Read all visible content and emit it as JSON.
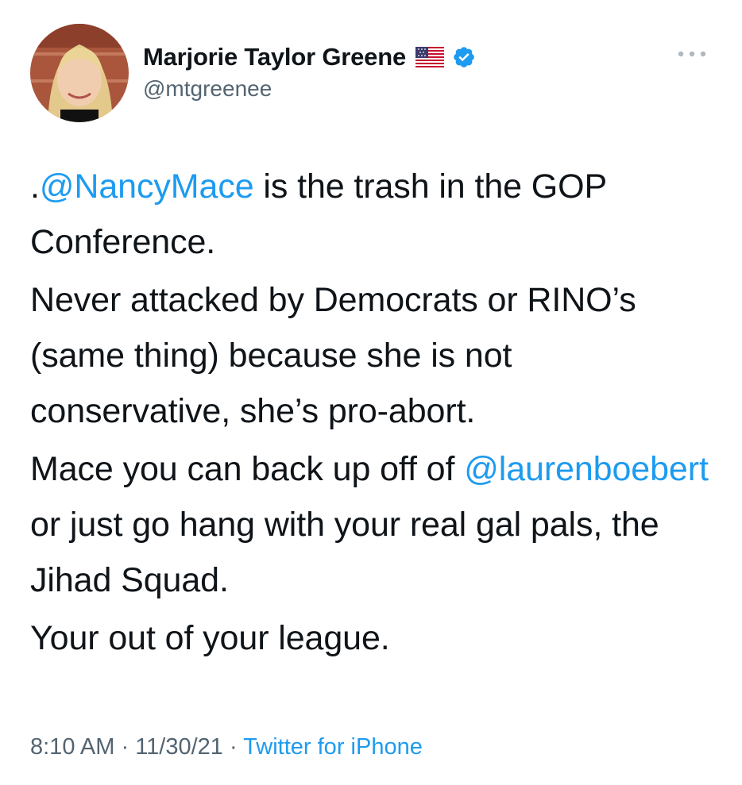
{
  "author": {
    "display_name": "Marjorie Taylor Greene",
    "handle": "@mtgreenee",
    "flag_icon": "us-flag-icon",
    "verified_icon": "verified-badge-icon",
    "verified_color": "#1d9bf0"
  },
  "menu": {
    "icon": "more-options-icon"
  },
  "tweet": {
    "p1": {
      "mention": "@NancyMace",
      "prefix": ".",
      "rest": " is the trash in the GOP Conference."
    },
    "p2": "Never attacked by Democrats or RINO’s (same thing) because she is not conservative, she’s pro-abort.",
    "p3": {
      "lead": "Mace you can back up off of ",
      "mention": "@laurenboebert",
      "rest": " or just go hang with your real gal pals, the Jihad Squad."
    },
    "p4": "Your out of your league."
  },
  "meta": {
    "time": "8:10 AM",
    "separator1": " · ",
    "date": "11/30/21",
    "separator2": " · ",
    "source": "Twitter for iPhone"
  },
  "colors": {
    "link": "#1d9bf0",
    "secondary_text": "#536471",
    "primary_text": "#0f1419"
  }
}
